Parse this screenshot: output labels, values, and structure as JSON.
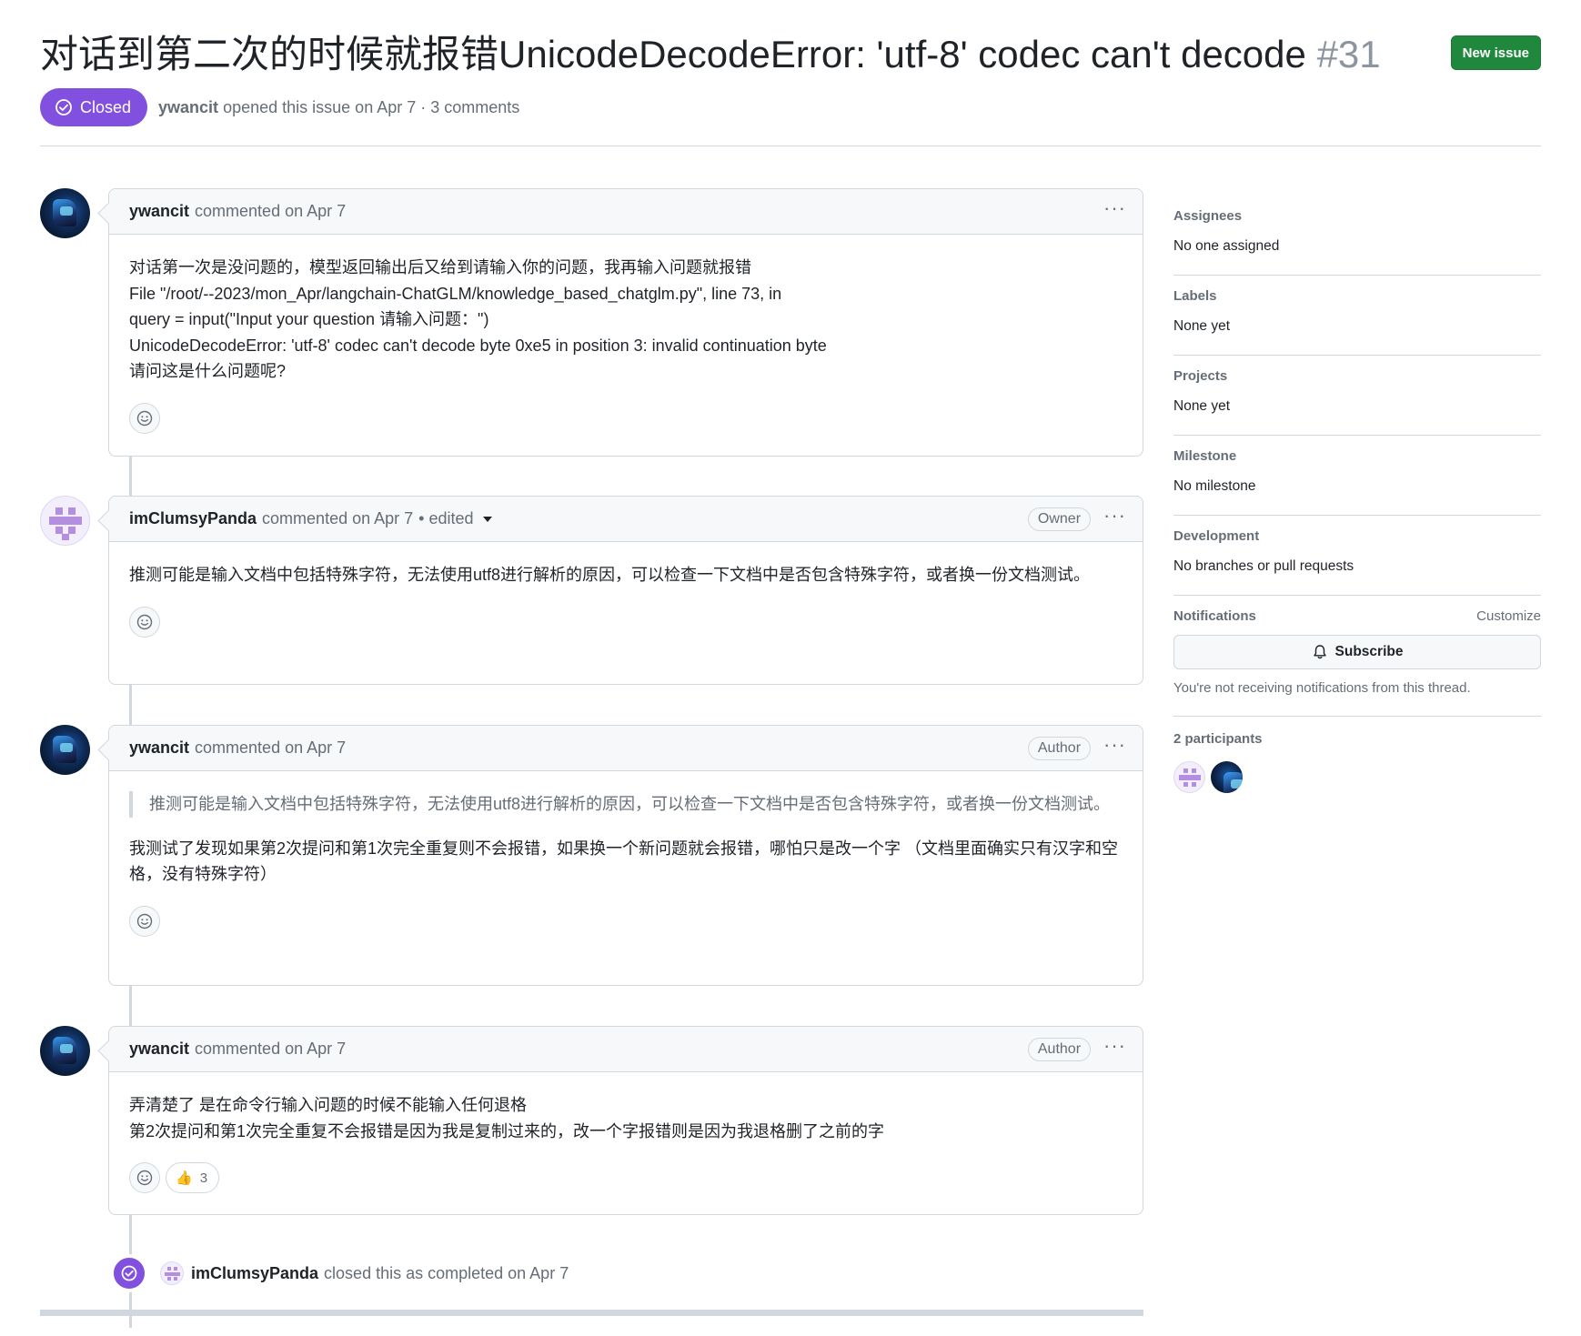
{
  "header": {
    "title": "对话到第二次的时候就报错UnicodeDecodeError: 'utf-8' codec can't decode",
    "number": "#31",
    "new_issue_label": "New issue",
    "state_label": "Closed",
    "author": "ywancit",
    "meta_text": "opened this issue on Apr 7 · 3 comments"
  },
  "comments": [
    {
      "author": "ywancit",
      "action": "commented on Apr 7",
      "lines": [
        "对话第一次是没问题的，模型返回输出后又给到请输入你的问题，我再输入问题就报错",
        "File \"/root/--2023/mon_Apr/langchain-ChatGLM/knowledge_based_chatglm.py\", line 73, in",
        "query = input(\"Input your question 请输入问题：\")",
        "UnicodeDecodeError: 'utf-8' codec can't decode byte 0xe5 in position 3: invalid continuation byte",
        "请问这是什么问题呢?"
      ]
    },
    {
      "author": "imClumsyPanda",
      "action": "commented on Apr 7",
      "edited": "• edited",
      "role": "Owner",
      "text": "推测可能是输入文档中包括特殊字符，无法使用utf8进行解析的原因，可以检查一下文档中是否包含特殊字符，或者换一份文档测试。"
    },
    {
      "author": "ywancit",
      "action": "commented on Apr 7",
      "role": "Author",
      "quote": "推测可能是输入文档中包括特殊字符，无法使用utf8进行解析的原因，可以检查一下文档中是否包含特殊字符，或者换一份文档测试。",
      "text": "我测试了发现如果第2次提问和第1次完全重复则不会报错，如果换一个新问题就会报错，哪怕只是改一个字 （文档里面确实只有汉字和空格，没有特殊字符）"
    },
    {
      "author": "ywancit",
      "action": "commented on Apr 7",
      "role": "Author",
      "lines": [
        "弄清楚了 是在命令行输入问题的时候不能输入任何退格",
        "第2次提问和第1次完全重复不会报错是因为我是复制过来的，改一个字报错则是因为我退格删了之前的字"
      ],
      "reaction_emoji": "👍",
      "reaction_count": "3"
    }
  ],
  "event": {
    "actor": "imClumsyPanda",
    "text": "closed this as completed on Apr 7"
  },
  "sidebar": {
    "assignees": {
      "heading": "Assignees",
      "value": "No one assigned"
    },
    "labels": {
      "heading": "Labels",
      "value": "None yet"
    },
    "projects": {
      "heading": "Projects",
      "value": "None yet"
    },
    "milestone": {
      "heading": "Milestone",
      "value": "No milestone"
    },
    "development": {
      "heading": "Development",
      "value": "No branches or pull requests"
    },
    "notifications": {
      "heading": "Notifications",
      "customize": "Customize",
      "subscribe_label": "Subscribe",
      "note": "You're not receiving notifications from this thread."
    },
    "participants": {
      "heading": "2 participants"
    }
  },
  "colors": {
    "closed_purple": "#8250df",
    "new_issue_green": "#1f883d",
    "border": "#d0d7de",
    "muted_text": "#656d76"
  }
}
